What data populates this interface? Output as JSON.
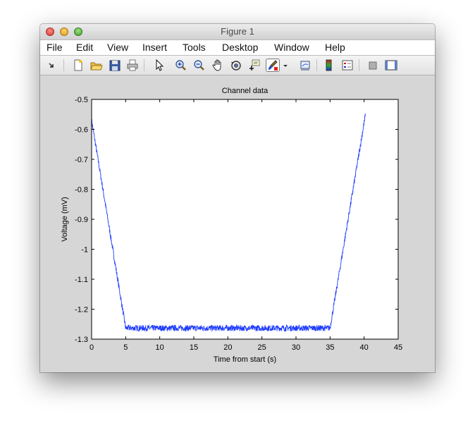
{
  "window": {
    "title": "Figure 1"
  },
  "menu": [
    {
      "label": "File"
    },
    {
      "label": "Edit"
    },
    {
      "label": "View"
    },
    {
      "label": "Insert"
    },
    {
      "label": "Tools"
    },
    {
      "label": "Desktop"
    },
    {
      "label": "Window"
    },
    {
      "label": "Help"
    }
  ],
  "toolbar": {
    "items": [
      {
        "icon": "dock-arrow-icon"
      },
      {
        "icon": "new-figure-icon"
      },
      {
        "icon": "open-file-icon"
      },
      {
        "icon": "save-icon"
      },
      {
        "icon": "print-icon"
      },
      {
        "icon": "pointer-icon"
      },
      {
        "icon": "zoom-in-icon"
      },
      {
        "icon": "zoom-out-icon"
      },
      {
        "icon": "pan-hand-icon"
      },
      {
        "icon": "rotate-3d-icon"
      },
      {
        "icon": "data-cursor-icon"
      },
      {
        "icon": "brush-icon"
      },
      {
        "icon": "link-plot-icon"
      },
      {
        "icon": "colorbar-icon"
      },
      {
        "icon": "legend-icon"
      },
      {
        "icon": "hide-plot-tools-icon"
      },
      {
        "icon": "show-plot-tools-icon"
      }
    ]
  },
  "colors": {
    "line": "#1f3cff",
    "axes_bg": "#ffffff",
    "figure_bg": "#d6d6d6"
  },
  "chart_data": {
    "type": "line",
    "title": "Channel data",
    "xlabel": "Time from start (s)",
    "ylabel": "Voltage (mV)",
    "xlim": [
      0,
      45
    ],
    "ylim": [
      -1.3,
      -0.5
    ],
    "xticks": [
      0,
      5,
      10,
      15,
      20,
      25,
      30,
      35,
      40,
      45
    ],
    "yticks": [
      -0.5,
      -0.6,
      -0.7,
      -0.8,
      -0.9,
      -1,
      -1.1,
      -1.2,
      -1.3
    ],
    "grid": false,
    "series": [
      {
        "x": [
          0,
          5,
          35,
          40.2
        ],
        "y": [
          -0.57,
          -1.263,
          -1.263,
          -0.55
        ],
        "noise_amplitude": 0.01
      }
    ]
  }
}
